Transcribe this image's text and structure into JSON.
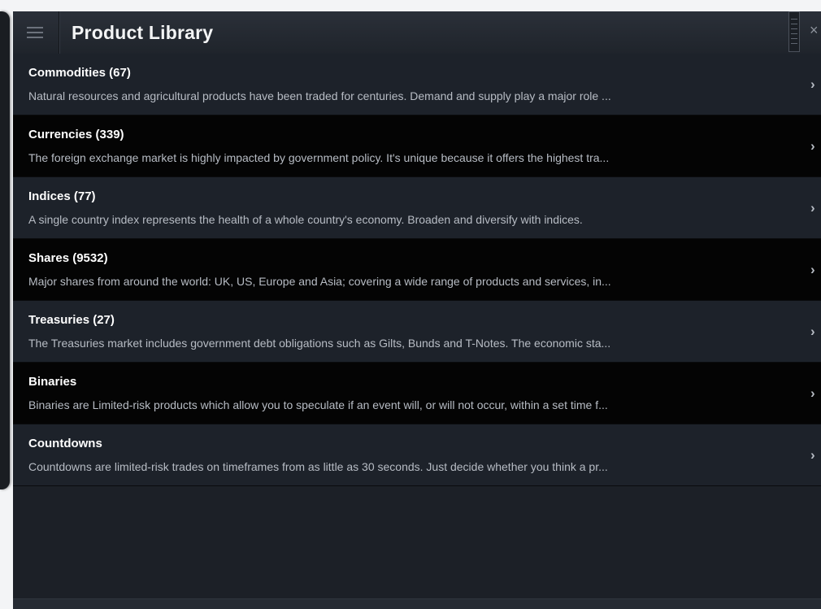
{
  "window": {
    "title": "Product Library",
    "close_glyph": "×",
    "menu_icon": "hamburger-icon",
    "close_icon": "close-icon"
  },
  "colors": {
    "title_bar": "#262b33",
    "row_odd": "#1d222a",
    "row_even": "#040404",
    "title_text": "#ffffff",
    "description_text": "#b7bcc4"
  },
  "products": [
    {
      "title": "Commodities (67)",
      "description": "Natural resources and agricultural products have been traded for centuries. Demand and supply play a major role ...",
      "chevron": "›"
    },
    {
      "title": "Currencies (339)",
      "description": "The foreign exchange market is highly impacted by government policy. It's unique because it offers the highest tra...",
      "chevron": "›"
    },
    {
      "title": "Indices (77)",
      "description": "A single country index represents the health of a whole country's economy. Broaden and diversify with indices.",
      "chevron": "›"
    },
    {
      "title": "Shares (9532)",
      "description": "Major shares from around the world: UK, US, Europe and Asia; covering a wide range of products and services, in...",
      "chevron": "›"
    },
    {
      "title": "Treasuries (27)",
      "description": "The Treasuries market includes government debt obligations such as Gilts, Bunds and T-Notes. The economic sta...",
      "chevron": "›"
    },
    {
      "title": "Binaries",
      "description": "Binaries are Limited-risk products which allow you to speculate if an event will, or will not occur, within a set time f...",
      "chevron": "›"
    },
    {
      "title": "Countdowns",
      "description": "Countdowns are limited-risk trades on timeframes from as little as 30 seconds.  Just decide whether you think a pr...",
      "chevron": "›"
    }
  ]
}
